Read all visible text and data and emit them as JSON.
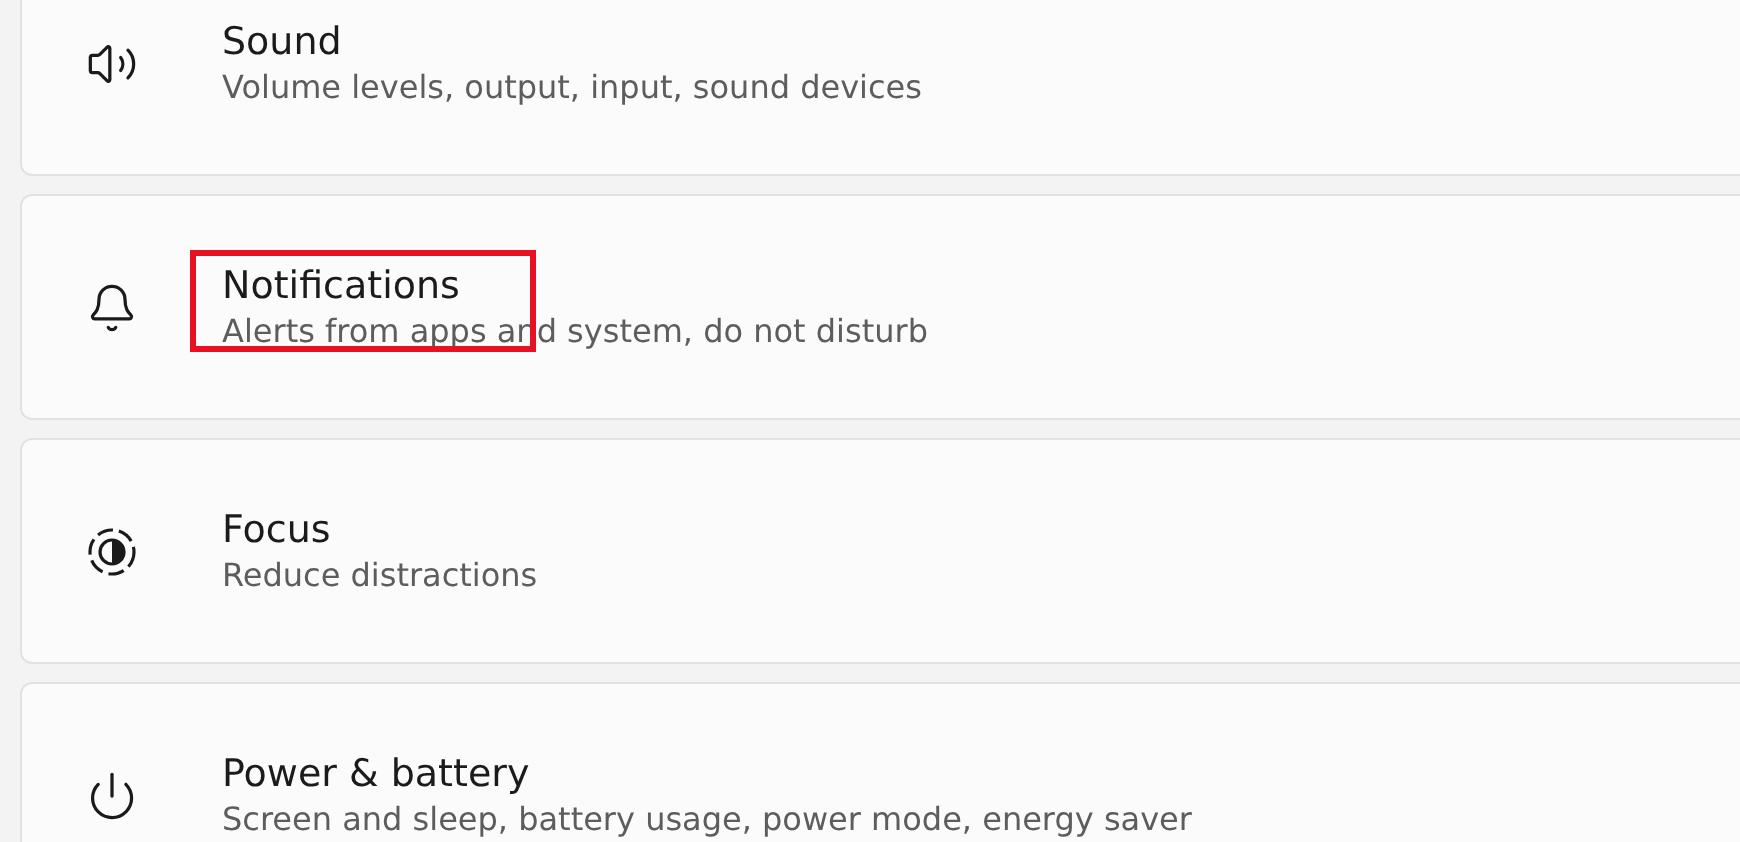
{
  "settings_items": [
    {
      "kind": "sound",
      "title": "Sound",
      "subtitle": "Volume levels, output, input, sound devices",
      "highlighted": false
    },
    {
      "kind": "notifications",
      "title": "Notifications",
      "subtitle": "Alerts from apps and system, do not disturb",
      "highlighted": true
    },
    {
      "kind": "focus",
      "title": "Focus",
      "subtitle": "Reduce distractions",
      "highlighted": false
    },
    {
      "kind": "power",
      "title": "Power & battery",
      "subtitle": "Screen and sleep, battery usage, power mode, energy saver",
      "highlighted": false
    }
  ]
}
